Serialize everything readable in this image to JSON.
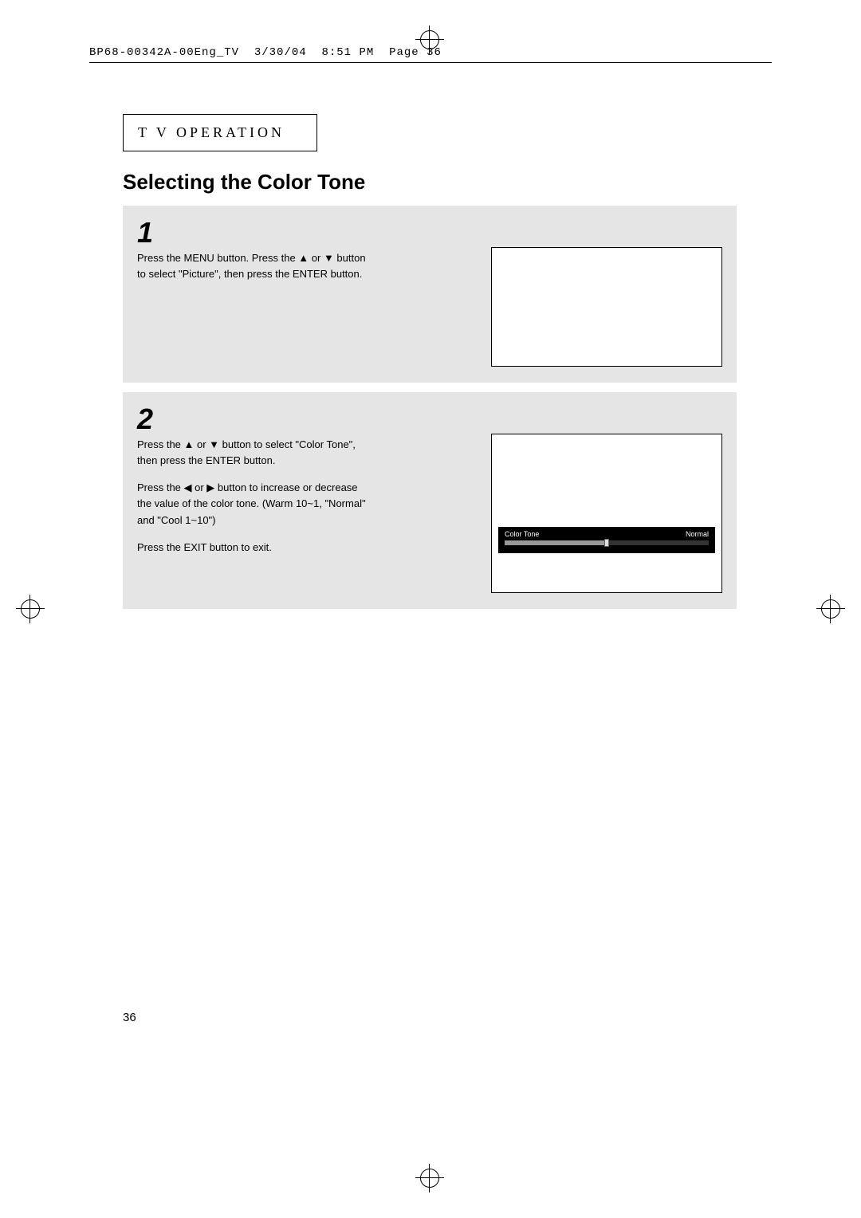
{
  "header": {
    "file": "BP68-00342A-00Eng_TV",
    "date": "3/30/04",
    "time": "8:51 PM",
    "page_label": "Page 36"
  },
  "section_label_1": "T V  O",
  "section_label_2": "PERATION",
  "title": "Selecting the Color Tone",
  "steps": [
    {
      "num": "1",
      "paragraphs": [
        "Press the MENU button. Press the ▲ or ▼ button to select \"Picture\", then press the ENTER button."
      ]
    },
    {
      "num": "2",
      "paragraphs": [
        "Press the ▲ or ▼ button to select \"Color Tone\", then press the ENTER button.",
        "Press the ◀ or ▶ button to increase or decrease the value of the color tone. (Warm 10~1, \"Normal\" and \"Cool 1~10\")",
        "Press the EXIT button to exit."
      ],
      "osd": {
        "label": "Color Tone",
        "value": "Normal"
      }
    }
  ],
  "page_number": "36"
}
